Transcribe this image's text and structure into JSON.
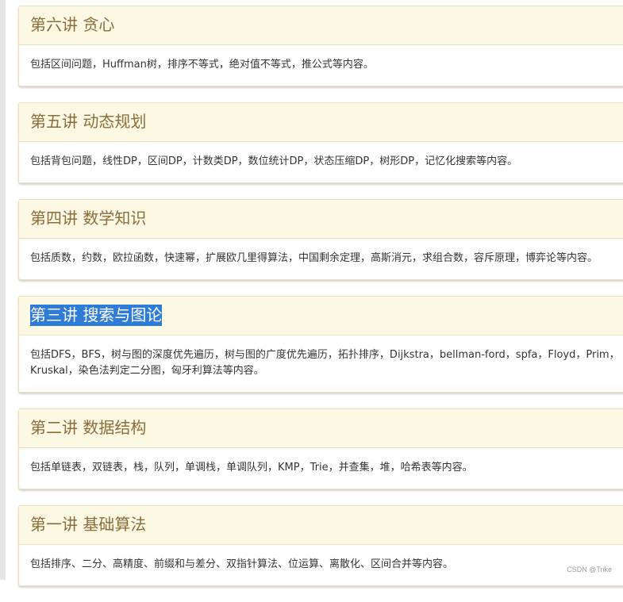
{
  "lectures": [
    {
      "title": "第六讲 贪心",
      "desc": "包括区间问题，Huffman树，排序不等式，绝对值不等式，推公式等内容。"
    },
    {
      "title": "第五讲 动态规划",
      "desc": "包括背包问题，线性DP，区间DP，计数类DP，数位统计DP，状态压缩DP，树形DP，记忆化搜索等内容。"
    },
    {
      "title": "第四讲 数学知识",
      "desc": "包括质数，约数，欧拉函数，快速幂，扩展欧几里得算法，中国剩余定理，高斯消元，求组合数，容斥原理，博弈论等内容。"
    },
    {
      "title": "第三讲 搜索与图论",
      "desc": "包括DFS，BFS，树与图的深度优先遍历，树与图的广度优先遍历，拓扑排序，Dijkstra，bellman-ford，spfa，Floyd，Prim，Kruskal，染色法判定二分图，匈牙利算法等内容。"
    },
    {
      "title": "第二讲 数据结构",
      "desc": "包括单链表，双链表，栈，队列，单调栈，单调队列，KMP，Trie，并查集，堆，哈希表等内容。"
    },
    {
      "title": "第一讲 基础算法",
      "desc": "包括排序、二分、高精度、前缀和与差分、双指针算法、位运算、离散化、区间合并等内容。"
    }
  ],
  "watermark": "CSDN @Trike",
  "colors": {
    "heading_bg": "#fcf8e3",
    "heading_text": "#8a6d3b",
    "border": "#f0e2b6",
    "selection": "#2f7bd8"
  }
}
